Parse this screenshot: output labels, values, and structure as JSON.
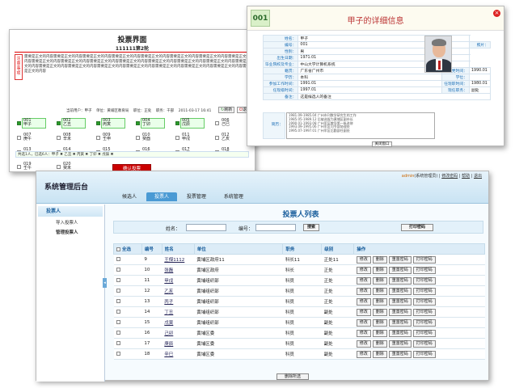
{
  "vote": {
    "title": "投票界面",
    "subtitle": "111111第2轮",
    "note_tag": "注意事项",
    "notes": "需要是正文的内容需要是正文的内容需要是正文的内容需要是正文的内容需要是正文的内容需要是正文的内容需要是正文的内容需要是正文的内容需要是正文的内容需要是正文的内容需要是正文的内容需要是正文的内容需要是正文的内容需要是正文的内容需要是正文的内容需要是正文的内容需要是正文的内容需要是正文的内容需要是正文的内容需要是正文的内容需要是正文的内容需要是正文的内容需要是正文的内容需要是正文的内容",
    "info": [
      "当前用户：甲子",
      "单位：黄埔区教育局",
      "职位：正处",
      "职务：干部",
      "2011-03-17 16:41"
    ],
    "btn_refresh": "刷新",
    "btn_exit": "退出",
    "candidates": [
      {
        "no": "001",
        "name": "甲子",
        "sel": true
      },
      {
        "no": "002",
        "name": "乙丑",
        "sel": true
      },
      {
        "no": "003",
        "name": "丙寅",
        "sel": true
      },
      {
        "no": "004",
        "name": "丁卯",
        "sel": true
      },
      {
        "no": "005",
        "name": "戊辰",
        "sel": true
      },
      {
        "no": "006",
        "name": "己巳",
        "sel": false
      },
      {
        "no": "007",
        "name": "庚午",
        "sel": false
      },
      {
        "no": "008",
        "name": "辛未",
        "sel": false
      },
      {
        "no": "009",
        "name": "壬申",
        "sel": false
      },
      {
        "no": "010",
        "name": "癸酉",
        "sel": false
      },
      {
        "no": "011",
        "name": "甲戌",
        "sel": false
      },
      {
        "no": "012",
        "name": "乙亥",
        "sel": false
      },
      {
        "no": "013",
        "name": "丙子",
        "sel": false
      },
      {
        "no": "014",
        "name": "丁丑",
        "sel": false
      },
      {
        "no": "015",
        "name": "戊寅",
        "sel": false
      },
      {
        "no": "016",
        "name": "己卯",
        "sel": false
      },
      {
        "no": "017",
        "name": "庚辰",
        "sel": false
      },
      {
        "no": "018",
        "name": "辛巳",
        "sel": false
      },
      {
        "no": "019",
        "name": "壬午",
        "sel": false
      },
      {
        "no": "020",
        "name": "癸未",
        "sel": false
      }
    ],
    "ballot": "共选1人，已选6人：甲子 ✖ 乙丑 ✖ 丙寅 ✖ 丁卯 ✖ 戊辰 ✖",
    "confirm": "确认投票"
  },
  "detail": {
    "id": "001",
    "title": "甲子的详细信息",
    "close": "×",
    "rows": [
      {
        "l": "姓名：",
        "v": "甲子",
        "l2": "",
        "v2": ""
      },
      {
        "l": "编号：",
        "v": "001",
        "l2": "",
        "v2": ""
      },
      {
        "l": "性别：",
        "v": "男",
        "l2": "",
        "v2": ""
      },
      {
        "l": "出生日期：",
        "v": "1971.01",
        "l2": "",
        "v2": ""
      },
      {
        "l": "毕业院校及专业：",
        "v": "中山大学计算机系统",
        "l2": "",
        "v2": ""
      },
      {
        "l": "籍贯：",
        "v": "广东省广州市",
        "l2": "入党时间：",
        "v2": "1990.01"
      },
      {
        "l": "学历：",
        "v": "本科",
        "l2": "学位：",
        "v2": ""
      },
      {
        "l": "参加工作时间：",
        "v": "1991.01",
        "l2": "任现职时间：",
        "v2": "1980.01"
      },
      {
        "l": "任现级时间：",
        "v": "1997.01",
        "l2": "现任职务：",
        "v2": "副处"
      },
      {
        "l": "备注：",
        "v": "这是候选人的备注",
        "l2": "",
        "v2": ""
      }
    ],
    "photo_label": "照片：",
    "resume_label": "简历：",
    "resume": [
      "1981.09-1985.04 广州市刊数学研究生的工作",
      "1985.05-1989.12 后被选拔为黄埔区副市长",
      "1990.01-1993.08 广州军区教导第一纵进修",
      "1993.09-1995.06 广州军区司令部协理处",
      "1995.07-1997.01 广州军区后勤部任副处"
    ],
    "close_btn": "关闭窗口"
  },
  "admin": {
    "app_title": "系统管理后台",
    "user": "admin",
    "role": "(系统管理员)",
    "links": [
      "修改密码",
      "帮助",
      "退出"
    ],
    "nav": [
      "候选人",
      "投票人",
      "投票管理",
      "系统管理"
    ],
    "side_head": "投票人",
    "side_items": [
      "导入投票人",
      "管理投票人"
    ],
    "page_title": "投票人列表",
    "search": {
      "name_label": "姓名：",
      "no_label": "编号：",
      "btn": "搜索",
      "print_btn": "打印密码"
    },
    "headers": [
      "全选",
      "编号",
      "姓名",
      "单位",
      "职务",
      "级别",
      "操作"
    ],
    "rows": [
      [
        "9",
        "王傑1112",
        "黄埔区政府11",
        "科长11",
        "正处11"
      ],
      [
        "10",
        "张磊",
        "黄埔区政府",
        "科长",
        "正处"
      ],
      [
        "11",
        "甲戌",
        "黄埔组织部",
        "科员",
        "正处"
      ],
      [
        "12",
        "乙亥",
        "黄埔组织部",
        "科员",
        "正处"
      ],
      [
        "13",
        "丙子",
        "黄埔组织部",
        "科员",
        "正处"
      ],
      [
        "14",
        "丁丑",
        "黄埔组织部",
        "科员",
        "副处"
      ],
      [
        "15",
        "戊寅",
        "黄埔组织部",
        "科员",
        "副处"
      ],
      [
        "16",
        "己卯",
        "黄埔区委",
        "科员",
        "副处"
      ],
      [
        "17",
        "庚辰",
        "黄埔区委",
        "科员",
        "副处"
      ],
      [
        "18",
        "辛巳",
        "黄埔区委",
        "科员",
        "副处"
      ]
    ],
    "actions": [
      "修改",
      "删除",
      "重置密码",
      "打印密码"
    ],
    "delete_selected": "删除所选"
  }
}
